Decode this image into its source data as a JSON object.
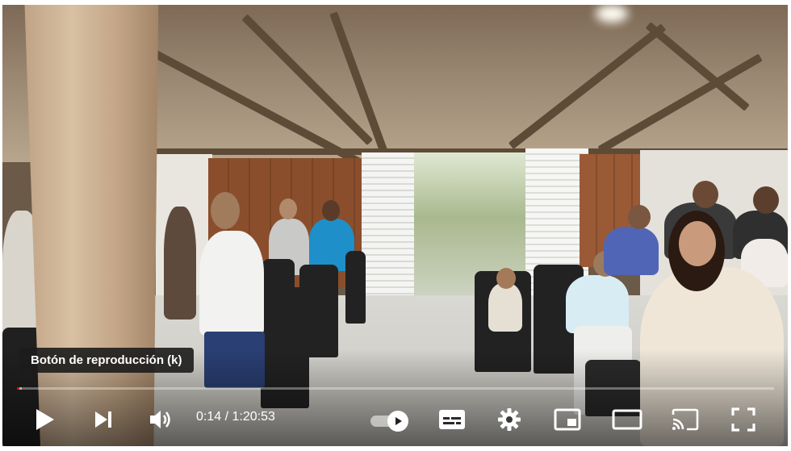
{
  "player": {
    "tooltip": "Botón de reproducción (k)",
    "time": {
      "current": "0:14",
      "separator": " / ",
      "duration": "1:20:53"
    },
    "progress": {
      "played_fraction": 0.003,
      "loaded_fraction": 0.006
    },
    "accent_color": "#ff0000",
    "controls": {
      "left": [
        "play-icon",
        "next-icon",
        "volume-icon"
      ],
      "right": [
        "autoplay-toggle",
        "subtitles-icon",
        "settings-gear-icon",
        "miniplayer-icon",
        "theater-mode-icon",
        "cast-icon",
        "fullscreen-icon"
      ]
    },
    "autoplay_on": true
  }
}
